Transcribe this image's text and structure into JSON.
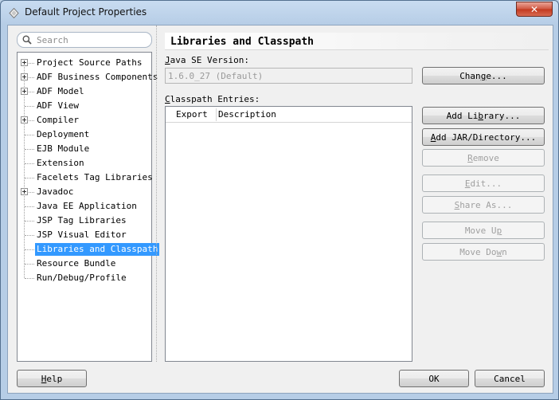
{
  "window": {
    "title": "Default Project Properties",
    "close_glyph": "✕"
  },
  "search": {
    "placeholder": "Search",
    "value": ""
  },
  "tree": {
    "items": [
      {
        "label": "Project Source Paths",
        "expandable": true,
        "selected": false
      },
      {
        "label": "ADF Business Components",
        "expandable": true,
        "selected": false
      },
      {
        "label": "ADF Model",
        "expandable": true,
        "selected": false
      },
      {
        "label": "ADF View",
        "expandable": false,
        "selected": false
      },
      {
        "label": "Compiler",
        "expandable": true,
        "selected": false
      },
      {
        "label": "Deployment",
        "expandable": false,
        "selected": false
      },
      {
        "label": "EJB Module",
        "expandable": false,
        "selected": false
      },
      {
        "label": "Extension",
        "expandable": false,
        "selected": false
      },
      {
        "label": "Facelets Tag Libraries",
        "expandable": false,
        "selected": false
      },
      {
        "label": "Javadoc",
        "expandable": true,
        "selected": false
      },
      {
        "label": "Java EE Application",
        "expandable": false,
        "selected": false
      },
      {
        "label": "JSP Tag Libraries",
        "expandable": false,
        "selected": false
      },
      {
        "label": "JSP Visual Editor",
        "expandable": false,
        "selected": false
      },
      {
        "label": "Libraries and Classpath",
        "expandable": false,
        "selected": true
      },
      {
        "label": "Resource Bundle",
        "expandable": false,
        "selected": false
      },
      {
        "label": "Run/Debug/Profile",
        "expandable": false,
        "selected": false
      }
    ]
  },
  "panel": {
    "title": "Libraries and Classpath",
    "java_label_mnemonic": "J",
    "java_label_rest": "ava SE Version:",
    "java_value": "1.6.0_27 (Default)",
    "classpath_label_mnemonic": "C",
    "classpath_label_rest": "lasspath Entries:",
    "columns": [
      "Export",
      "Description"
    ]
  },
  "buttons": {
    "change": {
      "pre": "Chan",
      "mn": "g",
      "post": "e..."
    },
    "add_library": {
      "pre": "Add Li",
      "mn": "b",
      "post": "rary..."
    },
    "add_jar": {
      "pre": "",
      "mn": "A",
      "post": "dd JAR/Directory..."
    },
    "remove": {
      "pre": "",
      "mn": "R",
      "post": "emove"
    },
    "edit": {
      "pre": "",
      "mn": "E",
      "post": "dit..."
    },
    "share_as": {
      "pre": "",
      "mn": "S",
      "post": "hare As..."
    },
    "move_up": {
      "pre": "Move U",
      "mn": "p",
      "post": ""
    },
    "move_down": {
      "pre": "Move Do",
      "mn": "w",
      "post": "n"
    },
    "help": {
      "pre": "",
      "mn": "H",
      "post": "elp"
    },
    "ok": "OK",
    "cancel": "Cancel"
  },
  "colors": {
    "selection": "#3399ff",
    "close_button": "#c2381f"
  }
}
